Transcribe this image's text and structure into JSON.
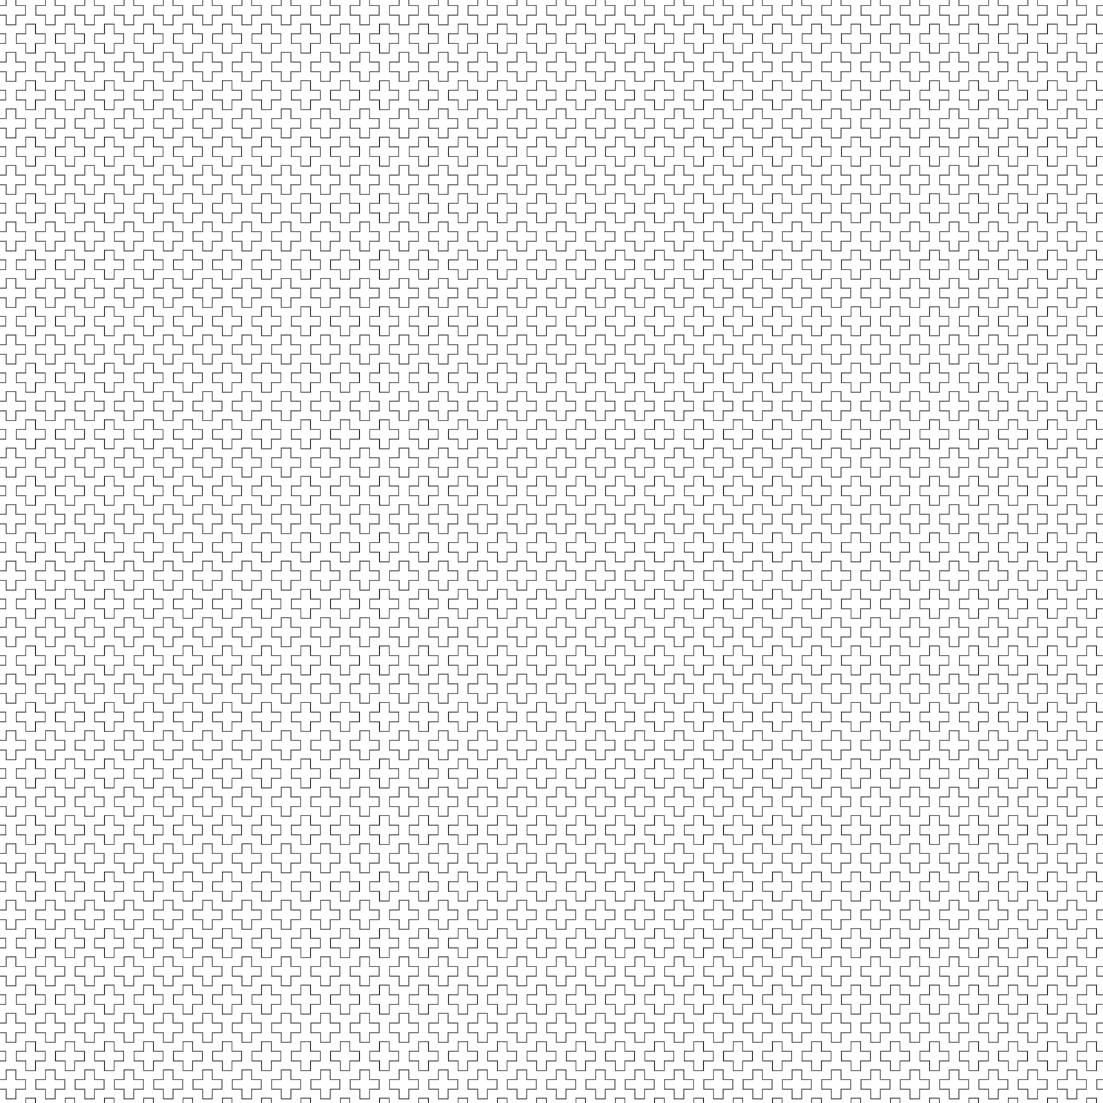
{
  "pattern": {
    "motif": "greek-cross-outline",
    "arrangement": "staggered-grid",
    "background_color": "#ffffff",
    "stroke_color": "#333333"
  }
}
